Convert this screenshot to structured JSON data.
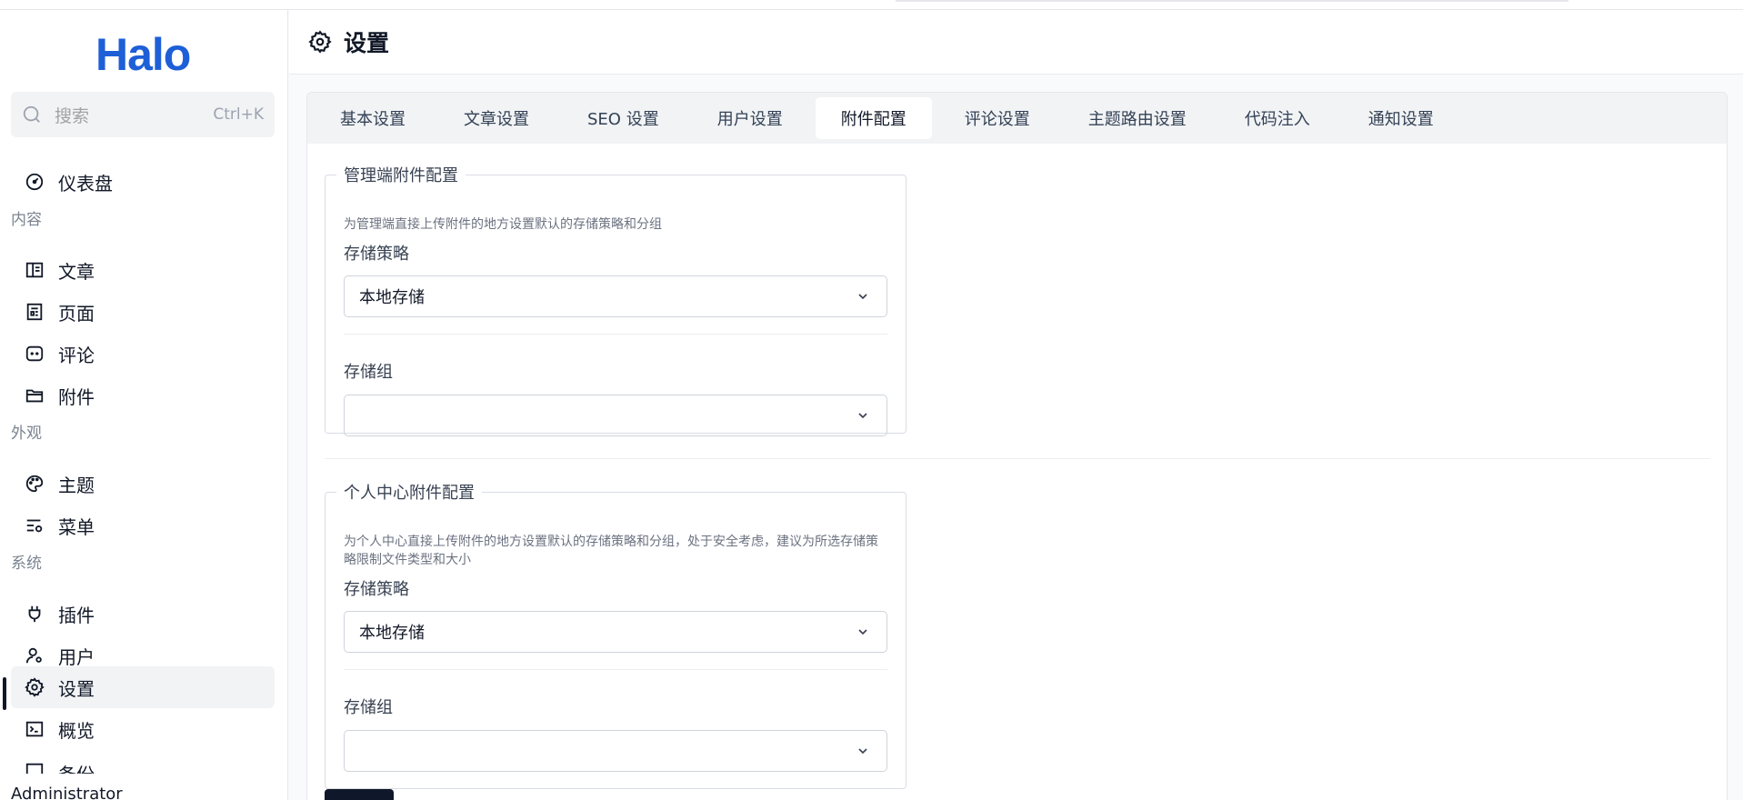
{
  "app": {
    "logo_text": "Halo",
    "brand_color": "#1e5fd8"
  },
  "search": {
    "placeholder": "搜索",
    "shortcut": "Ctrl+K"
  },
  "sidebar": {
    "dashboard": "仪表盘",
    "groups": {
      "content": "内容",
      "appearance": "外观",
      "system": "系统"
    },
    "items": {
      "posts": "文章",
      "pages": "页面",
      "comments": "评论",
      "attachments": "附件",
      "themes": "主题",
      "menus": "菜单",
      "plugins": "插件",
      "users": "用户",
      "settings": "设置",
      "overview": "概览",
      "backup": "备份"
    },
    "active_item": "设置",
    "user_name": "Administrator"
  },
  "header": {
    "title": "设置",
    "icon": "gear-icon"
  },
  "tabs": [
    {
      "label": "基本设置",
      "active": false
    },
    {
      "label": "文章设置",
      "active": false
    },
    {
      "label": "SEO 设置",
      "active": false
    },
    {
      "label": "用户设置",
      "active": false
    },
    {
      "label": "附件配置",
      "active": true
    },
    {
      "label": "评论设置",
      "active": false
    },
    {
      "label": "主题路由设置",
      "active": false
    },
    {
      "label": "代码注入",
      "active": false
    },
    {
      "label": "通知设置",
      "active": false
    }
  ],
  "sections": {
    "console": {
      "legend": "管理端附件配置",
      "description": "为管理端直接上传附件的地方设置默认的存储策略和分组",
      "policy_label": "存储策略",
      "policy_value": "本地存储",
      "group_label": "存储组",
      "group_value": ""
    },
    "uc": {
      "legend": "个人中心附件配置",
      "description": "为个人中心直接上传附件的地方设置默认的存储策略和分组，处于安全考虑，建议为所选存储策略限制文件类型和大小",
      "policy_label": "存储策略",
      "policy_value": "本地存储",
      "group_label": "存储组",
      "group_value": ""
    }
  },
  "actions": {
    "save_label": ""
  }
}
